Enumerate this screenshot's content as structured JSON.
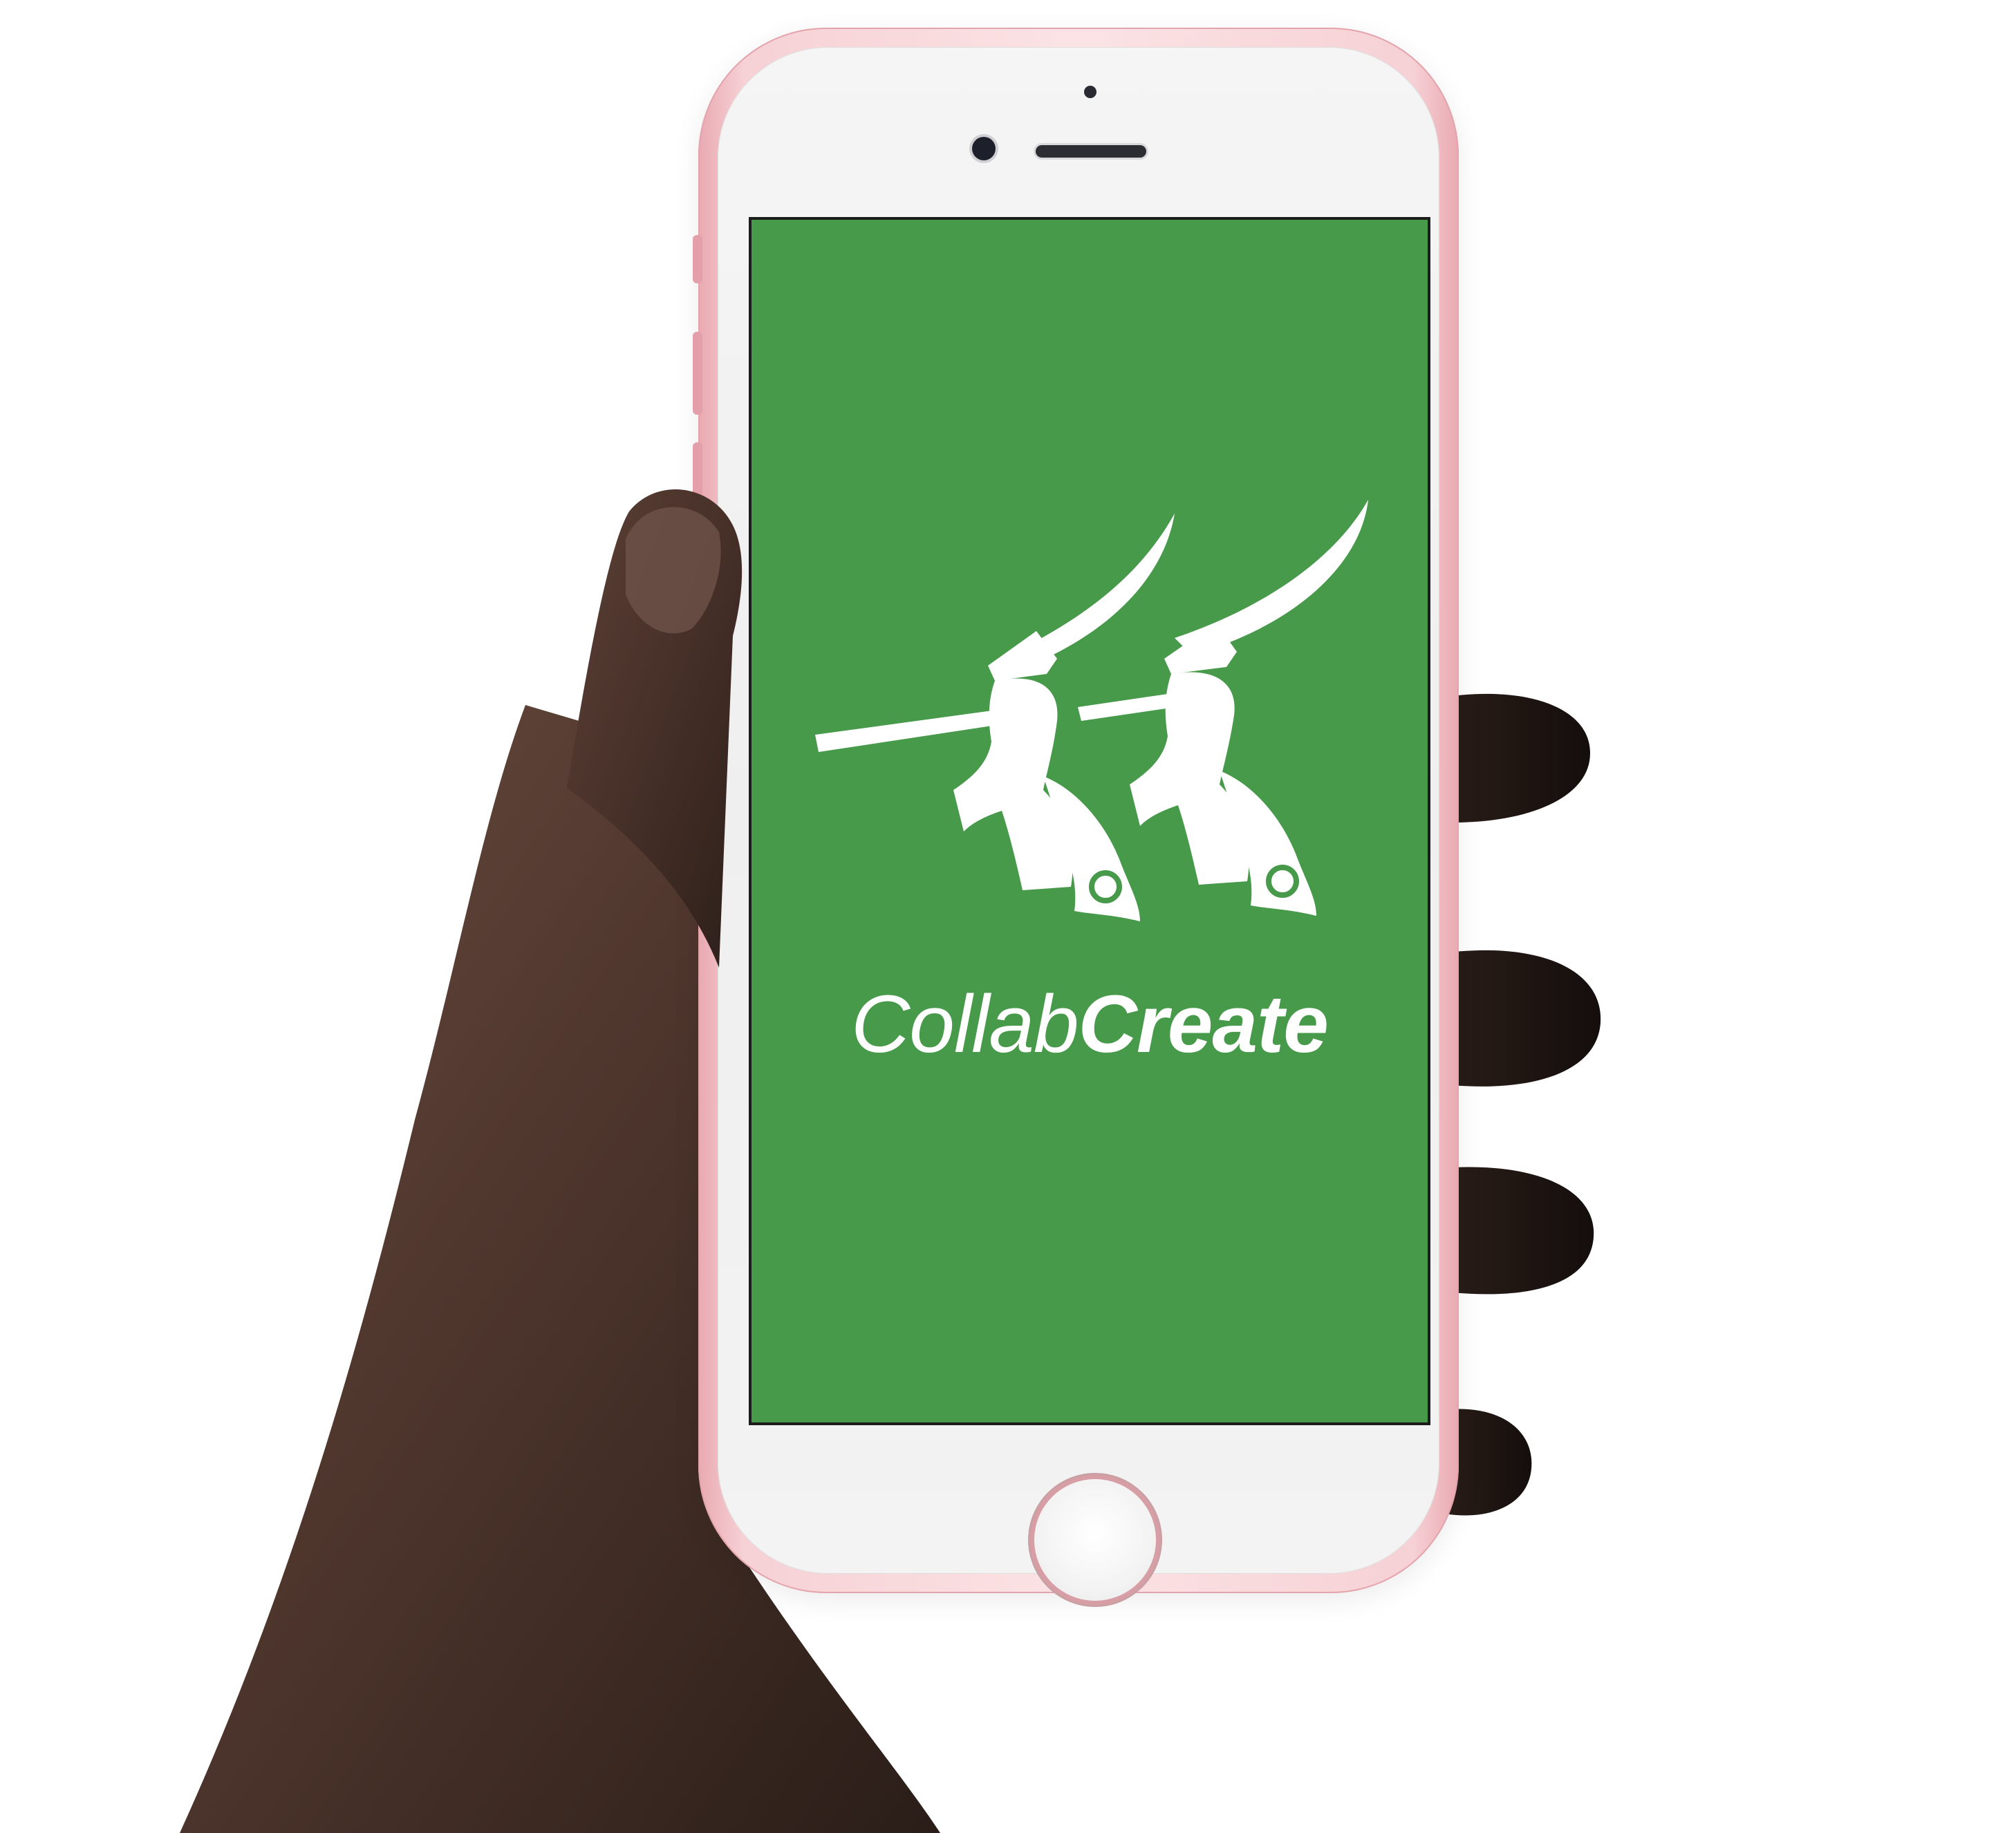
{
  "app": {
    "name_light": "Collab",
    "name_bold": "Create"
  },
  "colors": {
    "splash_background": "#469a4a",
    "logo": "#ffffff",
    "phone_body": "#f6d1d5",
    "phone_face": "#f3f3f3"
  },
  "icons": {
    "logo": "two-trumpeters-logo-icon",
    "home": "home-button"
  }
}
